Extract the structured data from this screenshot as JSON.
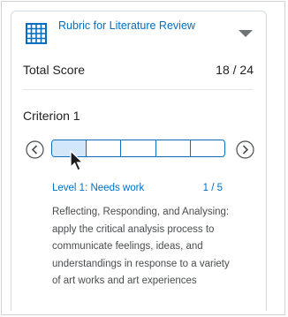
{
  "rubric": {
    "title": "Rubric for Literature Review",
    "icon": "grid-icon",
    "collapse_icon": "chevron-down-icon"
  },
  "score": {
    "label": "Total Score",
    "value": "18  / 24"
  },
  "criterion": {
    "title": "Criterion 1",
    "levels_total": 5,
    "selected_level_index": 0,
    "selected_level": {
      "name": "Level 1: Needs work",
      "count": "1 / 5",
      "description": "Reflecting, Responding, and Analysing: apply the critical analysis process to communicate feelings, ideas, and understandings in response to a variety of art works and art experiences"
    }
  },
  "colors": {
    "link": "#006fbf",
    "accent": "#0b6fba",
    "selected_fill": "#d2e7f9"
  }
}
